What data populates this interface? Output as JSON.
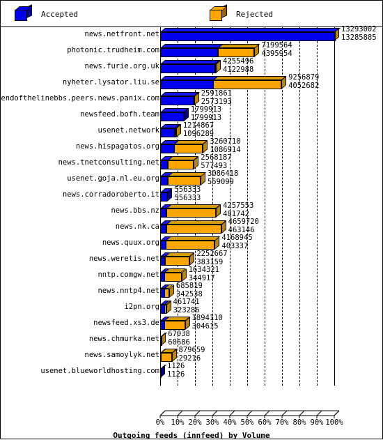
{
  "legend": {
    "items": [
      {
        "label": "Accepted",
        "color": "#0000ee",
        "icon": "cube-icon"
      },
      {
        "label": "Rejected",
        "color": "#ffa500",
        "icon": "cube-icon"
      }
    ]
  },
  "axis": {
    "title": "Outgoing feeds (innfeed) by Volume",
    "ticks": [
      "0%",
      "10%",
      "20%",
      "30%",
      "40%",
      "50%",
      "60%",
      "70%",
      "80%",
      "90%",
      "100%"
    ]
  },
  "chart_data": {
    "type": "bar",
    "orientation": "horizontal",
    "stacked": true,
    "title": "Outgoing feeds (innfeed) by Volume",
    "xlabel": "Outgoing feeds (innfeed) by Volume",
    "ylabel": "",
    "xlim": [
      0,
      100
    ],
    "xticks": [
      0,
      10,
      20,
      30,
      40,
      50,
      60,
      70,
      80,
      90,
      100
    ],
    "xtick_labels": [
      "0%",
      "10%",
      "20%",
      "30%",
      "40%",
      "50%",
      "60%",
      "70%",
      "80%",
      "90%",
      "100%"
    ],
    "grid": true,
    "legend_position": "top",
    "value_unit": "bytes",
    "scale_max": 13293002,
    "series": [
      {
        "name": "Accepted",
        "color": "#0000ee"
      },
      {
        "name": "Rejected",
        "color": "#ffa500"
      }
    ],
    "categories": [
      "news.netfront.net",
      "photonic.trudheim.com",
      "news.furie.org.uk",
      "nyheter.lysator.liu.se",
      "endofthelinebbs.peers.news.panix.com",
      "newsfeed.bofh.team",
      "usenet.network",
      "news.hispagatos.org",
      "news.tnetconsulting.net",
      "usenet.goja.nl.eu.org",
      "news.corradoroberto.it",
      "news.bbs.nz",
      "news.nk.ca",
      "news.quux.org",
      "news.weretis.net",
      "nntp.comgw.net",
      "news.nntp4.net",
      "i2pn.org",
      "newsfeed.xs3.de",
      "news.chmurka.net",
      "news.samoylyk.net",
      "usenet.blueworldhosting.com"
    ],
    "rows": [
      {
        "category": "news.netfront.net",
        "total": 13293002,
        "accepted": 13285885,
        "rejected": 7117,
        "label_total": "13293002",
        "label_accepted": "13285885"
      },
      {
        "category": "photonic.trudheim.com",
        "total": 7199564,
        "accepted": 4395954,
        "rejected": 2803610,
        "label_total": "7199564",
        "label_accepted": "4395954"
      },
      {
        "category": "news.furie.org.uk",
        "total": 4255496,
        "accepted": 4122988,
        "rejected": 132508,
        "label_total": "4255496",
        "label_accepted": "4122988"
      },
      {
        "category": "nyheter.lysator.liu.se",
        "total": 9256879,
        "accepted": 4052682,
        "rejected": 5204197,
        "label_total": "9256879",
        "label_accepted": "4052682"
      },
      {
        "category": "endofthelinebbs.peers.news.panix.com",
        "total": 2591861,
        "accepted": 2573193,
        "rejected": 18668,
        "label_total": "2591861",
        "label_accepted": "2573193"
      },
      {
        "category": "newsfeed.bofh.team",
        "total": 1799913,
        "accepted": 1799913,
        "rejected": 0,
        "label_total": "1799913",
        "label_accepted": "1799913"
      },
      {
        "category": "usenet.network",
        "total": 1214867,
        "accepted": 1096289,
        "rejected": 118578,
        "label_total": "1214867",
        "label_accepted": "1096289"
      },
      {
        "category": "news.hispagatos.org",
        "total": 3260710,
        "accepted": 1086914,
        "rejected": 2173796,
        "label_total": "3260710",
        "label_accepted": "1086914"
      },
      {
        "category": "news.tnetconsulting.net",
        "total": 2568187,
        "accepted": 577493,
        "rejected": 1990694,
        "label_total": "2568187",
        "label_accepted": "577493"
      },
      {
        "category": "usenet.goja.nl.eu.org",
        "total": 3086418,
        "accepted": 559099,
        "rejected": 2527319,
        "label_total": "3086418",
        "label_accepted": "559099"
      },
      {
        "category": "news.corradoroberto.it",
        "total": 556333,
        "accepted": 556333,
        "rejected": 0,
        "label_total": "556333",
        "label_accepted": "556333"
      },
      {
        "category": "news.bbs.nz",
        "total": 4257553,
        "accepted": 481742,
        "rejected": 3775811,
        "label_total": "4257553",
        "label_accepted": "481742"
      },
      {
        "category": "news.nk.ca",
        "total": 4659720,
        "accepted": 463146,
        "rejected": 4196574,
        "label_total": "4659720",
        "label_accepted": "463146"
      },
      {
        "category": "news.quux.org",
        "total": 4168945,
        "accepted": 403337,
        "rejected": 3765608,
        "label_total": "4168945",
        "label_accepted": "403337"
      },
      {
        "category": "news.weretis.net",
        "total": 2252667,
        "accepted": 383159,
        "rejected": 1869508,
        "label_total": "2252667",
        "label_accepted": "383159"
      },
      {
        "category": "nntp.comgw.net",
        "total": 1634321,
        "accepted": 344917,
        "rejected": 1289404,
        "label_total": "1634321",
        "label_accepted": "344917"
      },
      {
        "category": "news.nntp4.net",
        "total": 685819,
        "accepted": 342538,
        "rejected": 343281,
        "label_total": "685819",
        "label_accepted": "342538"
      },
      {
        "category": "i2pn.org",
        "total": 461741,
        "accepted": 323286,
        "rejected": 138455,
        "label_total": "461741",
        "label_accepted": "323286"
      },
      {
        "category": "newsfeed.xs3.de",
        "total": 1894110,
        "accepted": 304615,
        "rejected": 1589495,
        "label_total": "1894110",
        "label_accepted": "304615"
      },
      {
        "category": "news.chmurka.net",
        "total": 67038,
        "accepted": 60686,
        "rejected": 6352,
        "label_total": "67038",
        "label_accepted": "60686"
      },
      {
        "category": "news.samoylyk.net",
        "total": 879659,
        "accepted": 29216,
        "rejected": 850443,
        "label_total": "879659",
        "label_accepted": "29216"
      },
      {
        "category": "usenet.blueworldhosting.com",
        "total": 1126,
        "accepted": 1126,
        "rejected": 0,
        "label_total": "1126",
        "label_accepted": "1126"
      }
    ]
  }
}
